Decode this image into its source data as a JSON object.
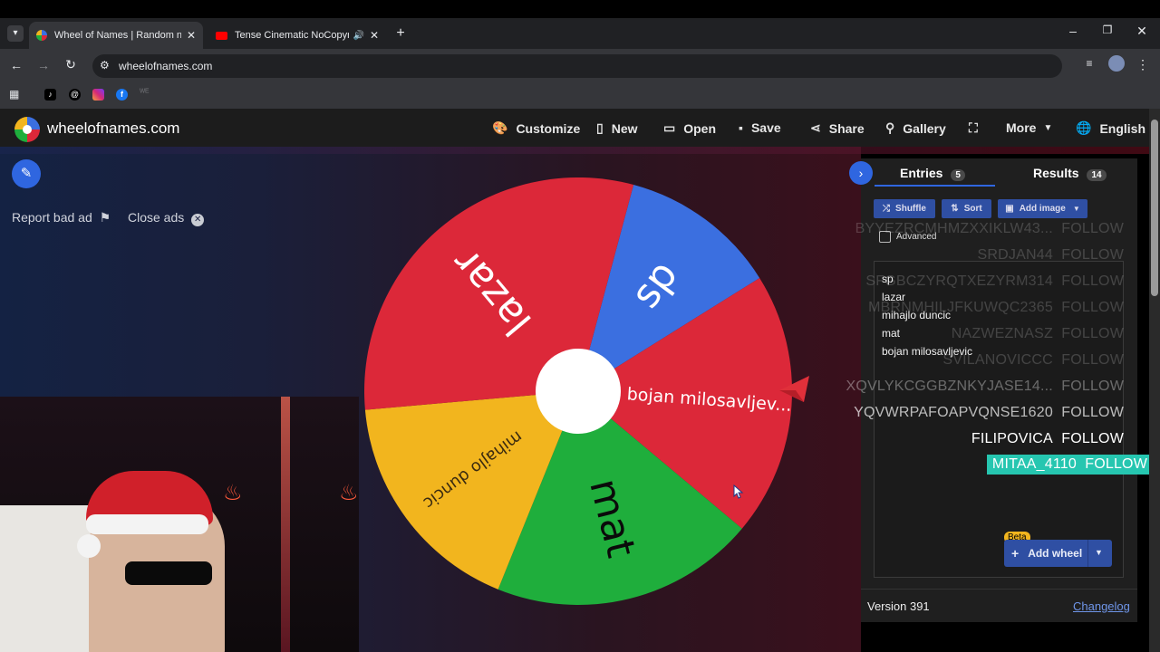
{
  "browser": {
    "tabs": [
      {
        "title": "Wheel of Names | Random nam",
        "active": true
      },
      {
        "title": "Tense Cinematic NoCopyrig",
        "active": false
      }
    ],
    "url": "wheelofnames.com"
  },
  "header": {
    "brand": "wheelofnames.com",
    "nav": {
      "customize": "Customize",
      "new": "New",
      "open": "Open",
      "save": "Save",
      "share": "Share",
      "gallery": "Gallery",
      "more": "More",
      "language": "English"
    }
  },
  "ads": {
    "report": "Report bad ad",
    "close": "Close ads"
  },
  "wheel": {
    "segments": [
      {
        "label": "sp",
        "color": "#3b6fe0"
      },
      {
        "label": "bojan milosavljev...",
        "color": "#dc2839"
      },
      {
        "label": "mat",
        "color": "#1fae3c"
      },
      {
        "label": "mihajlo duncic",
        "color": "#f2b51e"
      },
      {
        "label": "lazar",
        "color": "#dc2839"
      }
    ]
  },
  "panel": {
    "tabs": {
      "entries_label": "Entries",
      "entries_count": "5",
      "results_label": "Results",
      "results_count": "14"
    },
    "buttons": {
      "shuffle": "Shuffle",
      "sort": "Sort",
      "add_image": "Add image"
    },
    "advanced_label": "Advanced",
    "entries": [
      "sp",
      "lazar",
      "mihajlo duncic",
      "mat",
      "bojan milosavljevic"
    ],
    "beta_badge": "Beta",
    "add_wheel": "Add wheel",
    "version": "Version 391",
    "changelog": "Changelog"
  },
  "overlay_feed": [
    {
      "name": "BYYEZRCMHMZXXIKLW43...",
      "action": "FOLLOW"
    },
    {
      "name": "SRDJAN44",
      "action": "FOLLOW"
    },
    {
      "name": "SFGBCZYRQTXEZYRM314",
      "action": "FOLLOW"
    },
    {
      "name": "MBRNMHILJFKUWQC2365",
      "action": "FOLLOW"
    },
    {
      "name": "NAZWEZNASZ",
      "action": "FOLLOW"
    },
    {
      "name": "SVILANOVICCC",
      "action": "FOLLOW"
    },
    {
      "name": "XQVLYKCGGBZNKYJASE14...",
      "action": "FOLLOW"
    },
    {
      "name": "YQVWRPAFOAPVQNSE1620",
      "action": "FOLLOW"
    },
    {
      "name": "FILIPOVICA",
      "action": "FOLLOW"
    },
    {
      "name": "MITAA_4110",
      "action": "FOLLOW"
    }
  ],
  "colors": {
    "highlight": "#26c6b0",
    "accent_blue": "#2f4fa3",
    "pointer": "#e0303a"
  }
}
